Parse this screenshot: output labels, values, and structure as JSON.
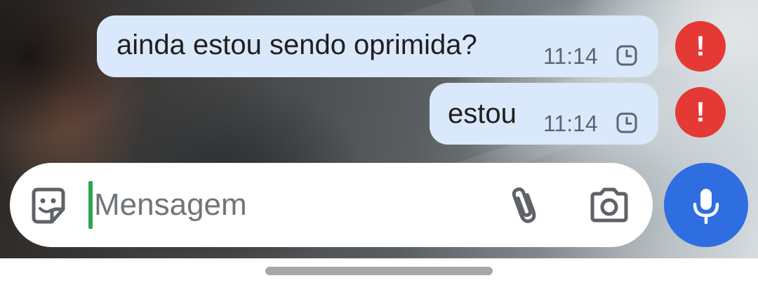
{
  "messages": [
    {
      "text": "ainda estou sendo oprimida?",
      "time": "11:14",
      "status_icon": "clock-icon",
      "error_badge": "!"
    },
    {
      "text": "estou",
      "time": "11:14",
      "status_icon": "clock-icon",
      "error_badge": "!"
    }
  ],
  "composer": {
    "value": "",
    "placeholder": "Mensagem",
    "left_icon": "sticker-icon",
    "attach_icon": "paperclip-icon",
    "camera_icon": "camera-icon"
  },
  "mic_button": {
    "icon": "microphone-icon"
  },
  "colors": {
    "bubble": "#d9e8fb",
    "error_badge": "#e53935",
    "mic_button": "#2e6ee0",
    "cursor": "#2fa44f",
    "composer_bg": "#ffffff"
  }
}
